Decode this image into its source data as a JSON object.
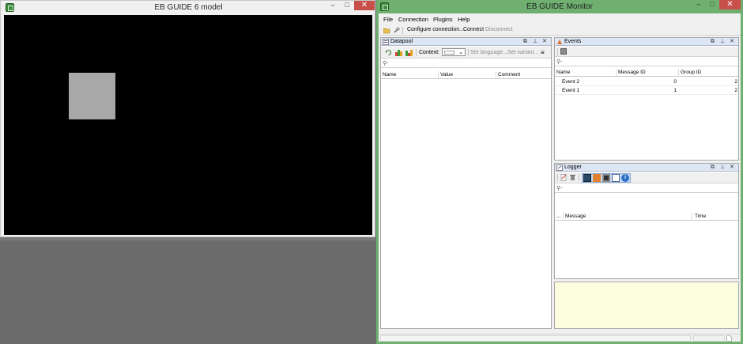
{
  "model_window": {
    "title": "EB GUIDE 6 model",
    "minimize_glyph": "‒",
    "maximize_glyph": "□",
    "close_glyph": "✕"
  },
  "monitor_window": {
    "title": "EB GUIDE Monitor",
    "minimize_glyph": "‒",
    "maximize_glyph": "□",
    "close_glyph": "✕",
    "menu": [
      "File",
      "Connection",
      "Plugins",
      "Help"
    ],
    "toolbar": {
      "configure_label": "Configure connection...",
      "connect_label": "Connect",
      "disconnect_label": "Disconnect"
    },
    "datapool": {
      "title": "Datapool",
      "context_label": "Context:",
      "set_language_label": "Set language...",
      "set_variant_label": "Set variant...",
      "search_placeholder": "",
      "columns": [
        "Name",
        "Value",
        "Comment"
      ]
    },
    "events": {
      "title": "Events",
      "columns": [
        "Name",
        "Message ID",
        "Group ID"
      ],
      "rows": [
        {
          "name": "Event 2",
          "message_id": "0",
          "group_id": "2"
        },
        {
          "name": "Event 1",
          "message_id": "1",
          "group_id": "2"
        }
      ]
    },
    "logger": {
      "title": "Logger",
      "columns": [
        "...",
        "Message",
        "Time"
      ]
    },
    "panel_controls": {
      "float": "⧉",
      "pin": "⊥",
      "close": "✕"
    }
  },
  "colors": {
    "monitor_frame": "#6fb070",
    "panel_title_bg": "#dce6f4",
    "logger_details_bg": "#fdfde0",
    "close_button": "#c7504b"
  }
}
